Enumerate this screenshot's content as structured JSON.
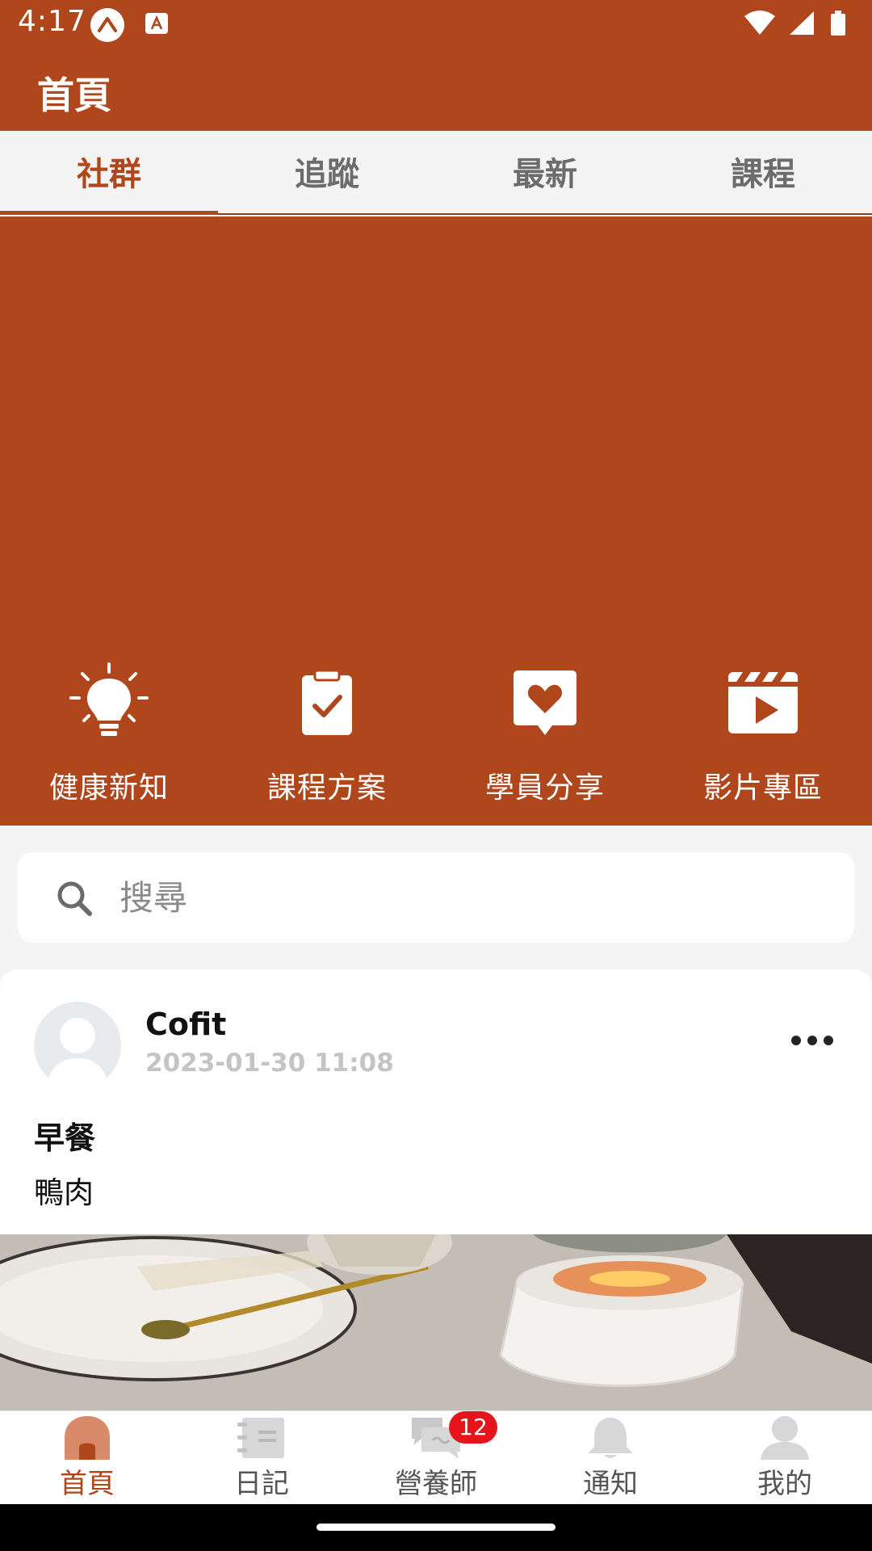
{
  "status_bar": {
    "time": "4:17",
    "icons": [
      "expo-app-icon",
      "keyboard-a-icon",
      "wifi-icon",
      "cell-signal-icon",
      "battery-icon"
    ]
  },
  "header": {
    "title": "首頁"
  },
  "tabs": [
    {
      "label": "社群",
      "active": true
    },
    {
      "label": "追蹤",
      "active": false
    },
    {
      "label": "最新",
      "active": false
    },
    {
      "label": "課程",
      "active": false
    }
  ],
  "quick_links": [
    {
      "label": "健康新知",
      "icon": "lightbulb-icon"
    },
    {
      "label": "課程方案",
      "icon": "clipboard-check-icon"
    },
    {
      "label": "學員分享",
      "icon": "heart-chat-icon"
    },
    {
      "label": "影片專區",
      "icon": "video-clapper-icon"
    }
  ],
  "search": {
    "placeholder": "搜尋",
    "value": ""
  },
  "post": {
    "author": "Cofit",
    "time": "2023-01-30 11:08",
    "title": "早餐",
    "body": "鴨肉",
    "image": "food-photo"
  },
  "bottom_nav": [
    {
      "label": "首頁",
      "icon": "home-icon",
      "active": true
    },
    {
      "label": "日記",
      "icon": "diary-icon",
      "active": false
    },
    {
      "label": "營養師",
      "icon": "chat-icon",
      "active": false,
      "badge": "12"
    },
    {
      "label": "通知",
      "icon": "bell-icon",
      "active": false
    },
    {
      "label": "我的",
      "icon": "profile-icon",
      "active": false
    }
  ],
  "colors": {
    "brand": "#b0461b",
    "badge": "#e8141c",
    "inactive_icon": "#d7d7d7"
  }
}
